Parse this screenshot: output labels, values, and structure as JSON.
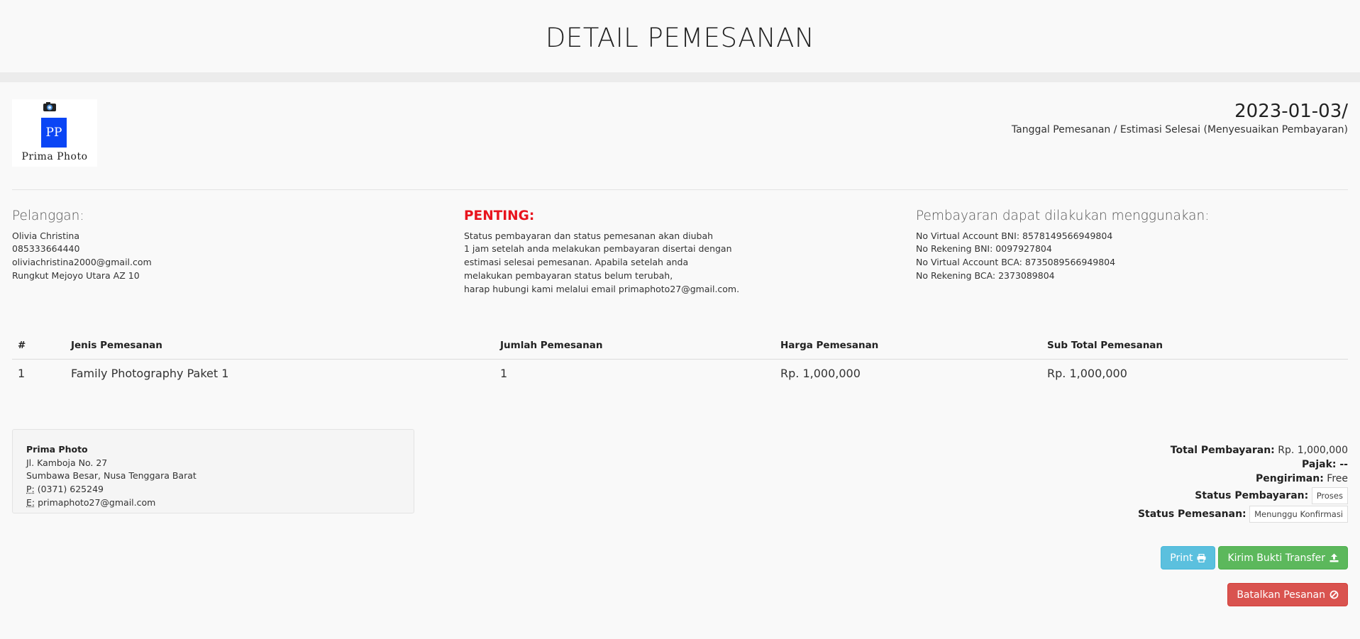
{
  "header": {
    "title": "DETAIL PEMESANAN"
  },
  "logo": {
    "mark": "PP",
    "text": "Prima Photo"
  },
  "order": {
    "date": "2023-01-03/",
    "date_caption": "Tanggal Pemesanan / Estimasi Selesai (Menyesuaikan Pembayaran)"
  },
  "customer": {
    "heading": "Pelanggan:",
    "lines": [
      "Olivia Christina",
      "085333664440",
      "oliviachristina2000@gmail.com",
      "Rungkut Mejoyo Utara AZ 10"
    ]
  },
  "important": {
    "heading": "PENTING:",
    "lines": [
      "Status pembayaran dan status pemesanan akan diubah",
      "1 jam setelah anda melakukan pembayaran disertai dengan",
      "estimasi selesai pemesanan. Apabila setelah anda",
      "melakukan pembayaran status belum terubah,",
      "harap hubungi kami melalui email primaphoto27@gmail.com."
    ]
  },
  "payment": {
    "heading": "Pembayaran dapat dilakukan menggunakan:",
    "lines": [
      "No Virtual Account BNI: 8578149566949804",
      "No Rekening BNI: 0097927804",
      "No Virtual Account BCA: 8735089566949804",
      "No Rekening BCA: 2373089804"
    ]
  },
  "table": {
    "headers": [
      "#",
      "Jenis Pemesanan",
      "Jumlah Pemesanan",
      "Harga Pemesanan",
      "Sub Total Pemesanan"
    ],
    "rows": [
      [
        "1",
        "Family Photography Paket 1",
        "1",
        "Rp. 1,000,000",
        "Rp. 1,000,000"
      ]
    ]
  },
  "company": {
    "name": "Prima Photo",
    "address1": "Jl. Kamboja No. 27",
    "address2": "Sumbawa Besar, Nusa Tenggara Barat",
    "phone_label": "P:",
    "phone": " (0371) 625249",
    "email_label": "E:",
    "email": " primaphoto27@gmail.com"
  },
  "totals": {
    "total_label": "Total Pembayaran:",
    "total_value": " Rp. 1,000,000",
    "tax_label": "Pajak:",
    "tax_value": " --",
    "shipping_label": "Pengiriman:",
    "shipping_value": " Free",
    "payment_status_label": "Status Pembayaran:",
    "payment_status_value": "Proses",
    "order_status_label": "Status Pemesanan:",
    "order_status_value": "Menunggu Konfirmasi"
  },
  "buttons": {
    "print": "Print",
    "upload": "Kirim Bukti Transfer",
    "cancel": "Batalkan Pesanan"
  },
  "icons": {
    "print": "printer-icon",
    "upload": "upload-icon",
    "cancel": "ban-icon"
  },
  "colors": {
    "info": "#5bc0de",
    "success": "#5cb85c",
    "danger": "#d9534f",
    "important": "#e8141e",
    "logo_blue": "#0a45f5"
  }
}
